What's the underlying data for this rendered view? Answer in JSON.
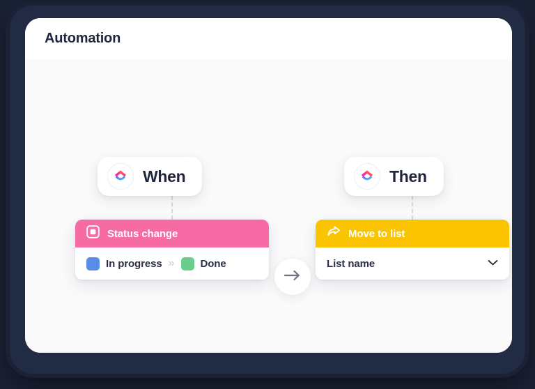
{
  "window": {
    "background_color": "#1b2236",
    "frame_color": "#222b44"
  },
  "app": {
    "title": "Automation",
    "card_background": "#ffffff",
    "body_background": "#fafafb"
  },
  "flow": {
    "trigger": {
      "pill_label": "When",
      "pill_icon": "clickup-logo-icon",
      "header_label": "Status change",
      "header_icon": "status-square-icon",
      "header_color": "#f76ba5",
      "statuses": [
        {
          "label": "In progress",
          "color": "#588ce8"
        },
        {
          "label": "Done",
          "color": "#69cd8d"
        }
      ],
      "separator": "»"
    },
    "connector": {
      "icon": "arrow-right-icon",
      "color": "#6b7182"
    },
    "action": {
      "pill_label": "Then",
      "pill_icon": "clickup-logo-icon",
      "header_label": "Move to list",
      "header_icon": "share-arrow-icon",
      "header_color": "#fac400",
      "dropdown_value": "List name",
      "dropdown_icon": "chevron-down-icon"
    }
  }
}
